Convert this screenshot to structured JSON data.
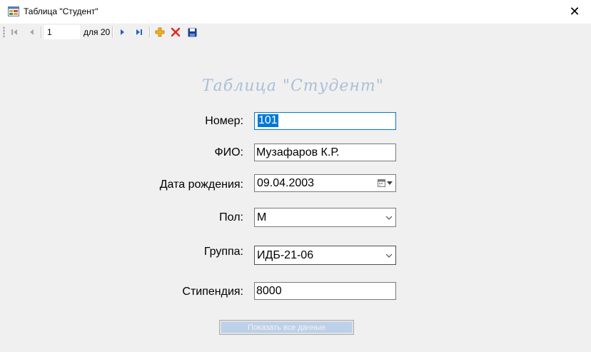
{
  "window": {
    "title": "Таблица \"Студент\"",
    "close_glyph": "✕"
  },
  "navigator": {
    "position": "1",
    "count_label": "для 20",
    "buttons": [
      "move-first-icon",
      "move-previous-icon",
      "move-next-icon",
      "move-last-icon",
      "add-icon",
      "delete-icon",
      "save-icon"
    ],
    "colors": {
      "nav": "#1c61c7",
      "add": "#f0b020",
      "delete": "#e0261b",
      "save": "#1c3f94"
    }
  },
  "form": {
    "heading": "Таблица \"Студент\"",
    "fields": {
      "number": {
        "label": "Номер:",
        "value": "101"
      },
      "fio": {
        "label": "ФИО:",
        "value": "Музафаров К.Р."
      },
      "birth_date": {
        "label": "Дата рождения:",
        "value": "09.04.2003"
      },
      "gender": {
        "label": "Пол:",
        "value": "М"
      },
      "group": {
        "label": "Группа:",
        "value": "ИДБ-21-06"
      },
      "stipend": {
        "label": "Стипендия:",
        "value": "8000"
      }
    },
    "show_all_label": "Показать все данные"
  }
}
